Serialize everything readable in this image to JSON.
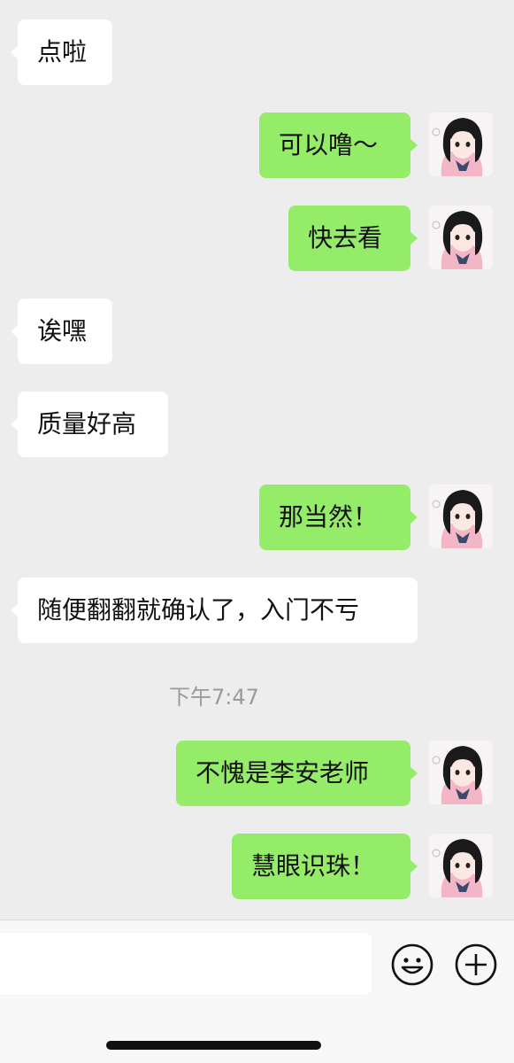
{
  "messages": [
    {
      "side": "in",
      "text": "点啦"
    },
    {
      "side": "out",
      "text": "可以噜～"
    },
    {
      "side": "out",
      "text": "快去看"
    },
    {
      "side": "in",
      "text": "诶嘿"
    },
    {
      "side": "in",
      "text": "质量好高"
    },
    {
      "side": "out",
      "text": "那当然！"
    },
    {
      "side": "in",
      "text": "随便翻翻就确认了，入门不亏"
    },
    {
      "side": "out",
      "text": "不愧是李安老师"
    },
    {
      "side": "out",
      "text": "慧眼识珠！"
    }
  ],
  "timestamp": "下午7:47",
  "input": {
    "value": "",
    "placeholder": ""
  },
  "icons": {
    "emoji": "smiley-face-icon",
    "more": "plus-circle-icon"
  },
  "colors": {
    "background": "#ededed",
    "outgoing_bubble": "#95ec69",
    "incoming_bubble": "#ffffff"
  }
}
